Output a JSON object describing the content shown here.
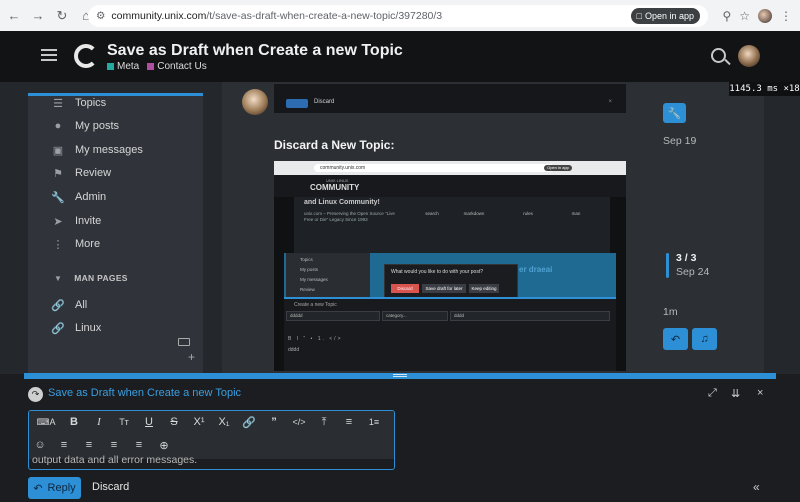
{
  "browser": {
    "url_host": "community.unix.com",
    "url_path": "/t/save-as-draft-when-create-a-new-topic/397280/3",
    "open_in_app": "Open in app"
  },
  "header": {
    "title": "Save as Draft when Create a new Topic",
    "categories": [
      {
        "label": "Meta",
        "color": "#25aaa2"
      },
      {
        "label": "Contact Us",
        "color": "#b04fa0"
      }
    ]
  },
  "perf_badge": "1145.3 ms ×18",
  "sidebar": {
    "items": [
      {
        "label": "Topics",
        "icon": "layers-icon"
      },
      {
        "label": "My posts",
        "icon": "user-icon"
      },
      {
        "label": "My messages",
        "icon": "inbox-icon"
      },
      {
        "label": "Review",
        "icon": "flag-icon"
      },
      {
        "label": "Admin",
        "icon": "wrench-icon"
      },
      {
        "label": "Invite",
        "icon": "paper-plane-icon"
      },
      {
        "label": "More",
        "icon": "more-icon"
      }
    ],
    "section_title": "MAN PAGES",
    "section_items": [
      {
        "label": "All",
        "icon": "link-icon"
      },
      {
        "label": "Linux",
        "icon": "link-icon"
      }
    ]
  },
  "post": {
    "top_shot": {
      "btn_label": "Reply",
      "text": "Discard"
    },
    "heading": "Discard a New Topic:",
    "embedded": {
      "url": "community.unix.com",
      "open_app": "Open in app",
      "logo_small": "UNIX LINUX",
      "logo": "COMMUNITY",
      "tagline": "and Linux Community!",
      "tagline2": "unix.com – Preserving the Open Source \"Live Free or Die\" Legacy Since 1993",
      "icons": [
        "search",
        "markdown",
        "rules",
        "man"
      ],
      "side_items": [
        "Topics",
        "My posts",
        "My messages",
        "Review"
      ],
      "modal_question": "What would you like to do with your post?",
      "modal_buttons": [
        "Discard",
        "Save draft for later",
        "Keep editing"
      ],
      "ghost_heading": "er draeai",
      "compose_title": "Create a new Topic",
      "field_title": "ddddd",
      "field_category": "category...",
      "field_tags": "dddd",
      "toolbar_preview": "B I “ • 1. </>",
      "body_text": "dddd"
    }
  },
  "timeline": {
    "first_date": "Sep 19",
    "counter": "3 / 3",
    "current_date": "Sep 24",
    "ago": "1m"
  },
  "composer": {
    "title": "Save as Draft when Create a new Topic",
    "editor_text": "output data and all error messages.",
    "reply_label": "Reply",
    "discard_label": "Discard"
  },
  "colors": {
    "accent": "#2d8fd5",
    "header_bg": "#111315",
    "page_bg": "#24282c"
  }
}
